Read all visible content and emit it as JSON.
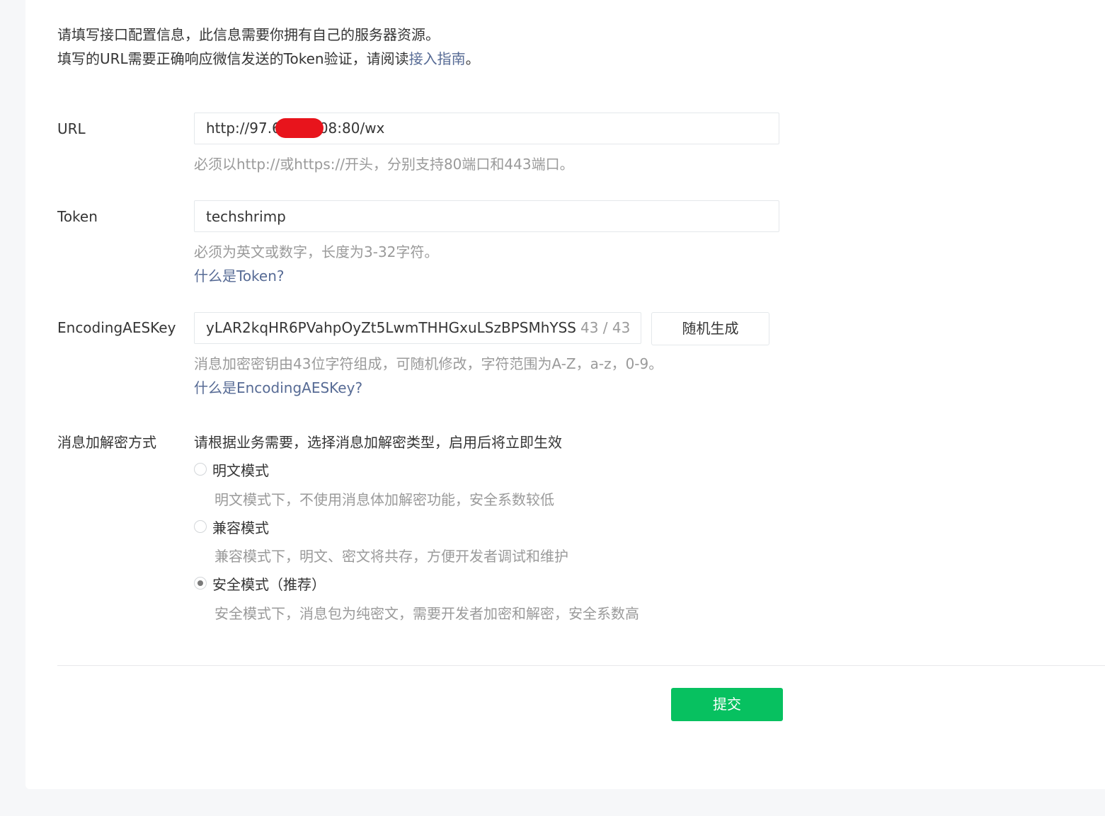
{
  "intro": {
    "line1": "请填写接口配置信息，此信息需要你拥有自己的服务器资源。",
    "line2_prefix": "填写的URL需要正确响应微信发送的Token验证，请阅读",
    "line2_link": "接入指南",
    "line2_suffix": "。"
  },
  "url": {
    "label": "URL",
    "value_prefix": "http://97.6",
    "value_suffix": "08:80/wx",
    "hint": "必须以http://或https://开头，分别支持80端口和443端口。"
  },
  "token": {
    "label": "Token",
    "value": "techshrimp",
    "hint": "必须为英文或数字，长度为3-32字符。",
    "help_link": "什么是Token?"
  },
  "aes": {
    "label": "EncodingAESKey",
    "value": "yLAR2kqHR6PVahpOyZt5LwmTHHGxuLSzBPSMhYSS",
    "counter": "43 / 43",
    "random_button": "随机生成",
    "hint": "消息加密密钥由43位字符组成，可随机修改，字符范围为A-Z，a-z，0-9。",
    "help_link": "什么是EncodingAESKey?"
  },
  "encryption": {
    "label": "消息加解密方式",
    "description": "请根据业务需要，选择消息加解密类型，启用后将立即生效",
    "options": [
      {
        "label": "明文模式",
        "desc": "明文模式下，不使用消息体加解密功能，安全系数较低",
        "checked": false
      },
      {
        "label": "兼容模式",
        "desc": "兼容模式下，明文、密文将共存，方便开发者调试和维护",
        "checked": false
      },
      {
        "label": "安全模式（推荐）",
        "desc": "安全模式下，消息包为纯密文，需要开发者加密和解密，安全系数高",
        "checked": true
      }
    ]
  },
  "submit_button": "提交",
  "colors": {
    "primary": "#07c160",
    "link": "#576b95",
    "redaction": "#e8141c"
  }
}
